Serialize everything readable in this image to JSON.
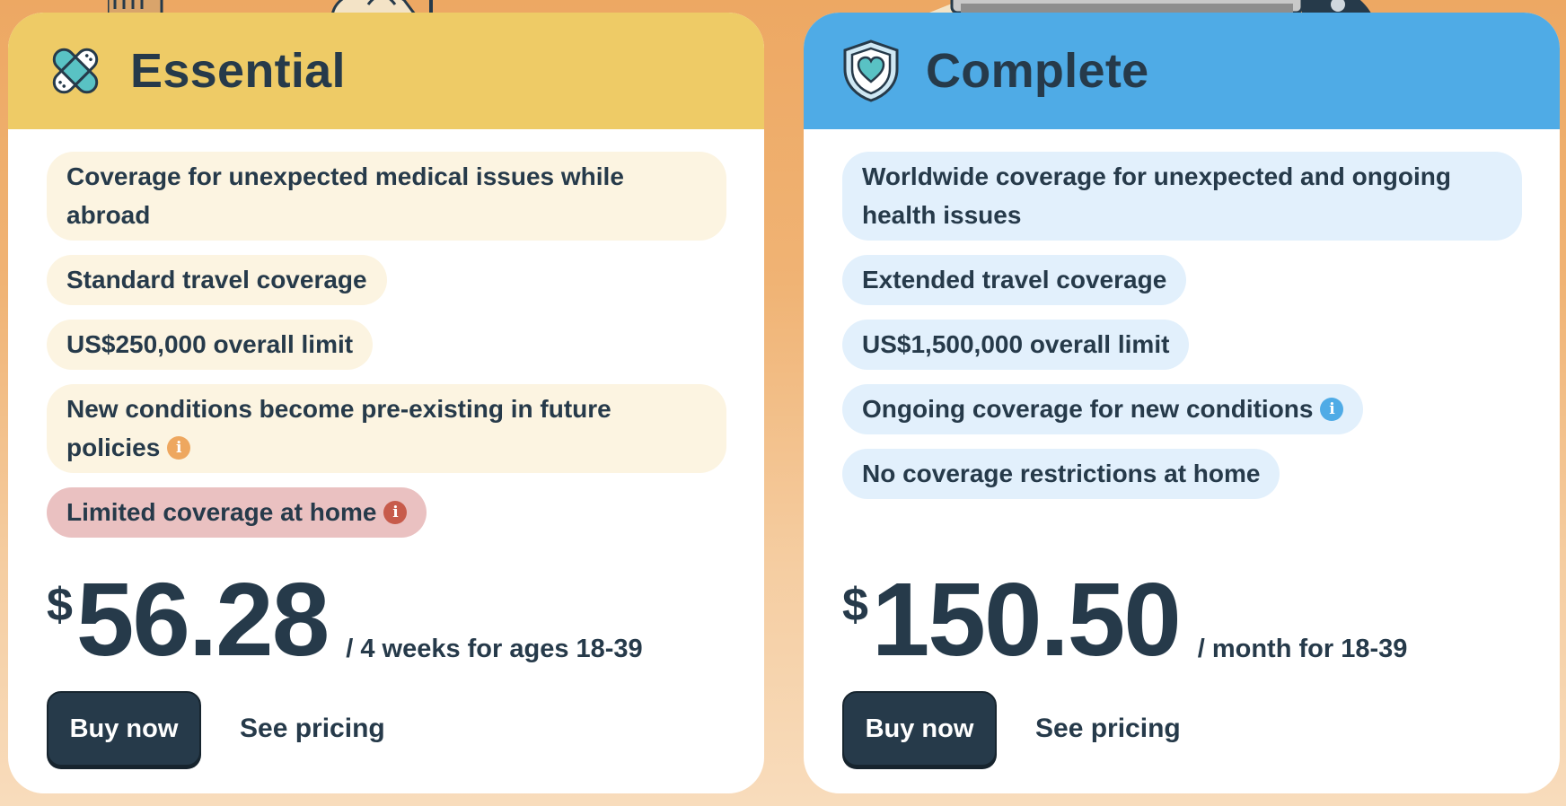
{
  "plans": [
    {
      "name": "Essential",
      "icon": "bandage-icon",
      "accent": "#eecb66",
      "features": [
        "Coverage for unexpected medical issues while abroad",
        "Standard travel coverage",
        "US$250,000 overall limit",
        "New conditions become pre-existing in future policies",
        "Limited coverage at home"
      ],
      "currency": "$",
      "price": "56.28",
      "period": "/ 4 weeks for ages 18-39",
      "buy_label": "Buy now",
      "pricing_label": "See pricing"
    },
    {
      "name": "Complete",
      "icon": "shield-heart-icon",
      "accent": "#4fabe6",
      "features": [
        "Worldwide coverage for unexpected and ongoing health issues",
        "Extended travel coverage",
        "US$1,500,000 overall limit",
        "Ongoing coverage for new conditions",
        "No coverage restrictions at home"
      ],
      "currency": "$",
      "price": "150.50",
      "period": "/ month for 18-39",
      "buy_label": "Buy now",
      "pricing_label": "See pricing"
    }
  ],
  "info_icon_glyph": "i"
}
